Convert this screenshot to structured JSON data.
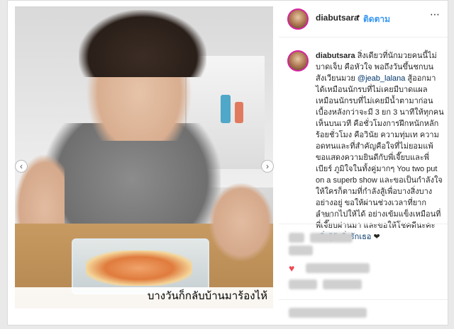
{
  "header": {
    "username": "diabutsara",
    "separator": "•",
    "follow_label": "ติดตาม",
    "more_icon": "more-horizontal-icon"
  },
  "photo": {
    "caption": "บางวันก็กลับบ้านมาร้องไห้",
    "prev_icon": "chevron-left-icon",
    "next_icon": "chevron-right-icon"
  },
  "comment": {
    "username": "diabutsara",
    "text_part1": " สิ่งเดียวที่นักมวยคนนี้ไม่บาดเจ็บ คือหัวใจ พอถึงวันขึ้นชกบนสังเวียนมวย ",
    "mention": "@jeab_lalana",
    "text_part2": " สู้ออกมาได้เหมือนนักรบที่ไม่เคยมีบาดแผล เหมือนนักรบที่ไม่เคยมีน้ำตามาก่อน เบื้องหลังกว่าจะมี 3 ยก 3 นาทีให้ทุกคนเห็นบนเวที คือชั่วโมงการฝึกหนักหลักร้อยชั่วโมง คือวินัย ความทุ่มเท ความอดทนและที่สำคัญคือใจที่ไม่ยอมแพ้ ขอแสดงความยินดีกับพี่เจี๊ยบและพี่เบียร์ ภูมิใจในทั้งคู่มากๆ  You two put on a superb show และขอเป็นกำลังใจให้ใครก็ตามที่กำลังสู้เพื่อบางสิ่งบางอย่างอยู่ ขอให้ผ่านช่วงเวลาที่ยากลำบากไปให้ได้ อย่างเข้มแข็งเหมือนที่พี่เจี๊ยบผ่านมา และขอให้โชคดีนะคะ ",
    "hashtag": "#ยิ่งรู้จักยิ่งรักเธอ",
    "trailing": " ❤"
  },
  "timestamp": "5 ชม.",
  "colors": {
    "follow": "#3897f0",
    "link": "#003569",
    "like": "#ed4956"
  }
}
